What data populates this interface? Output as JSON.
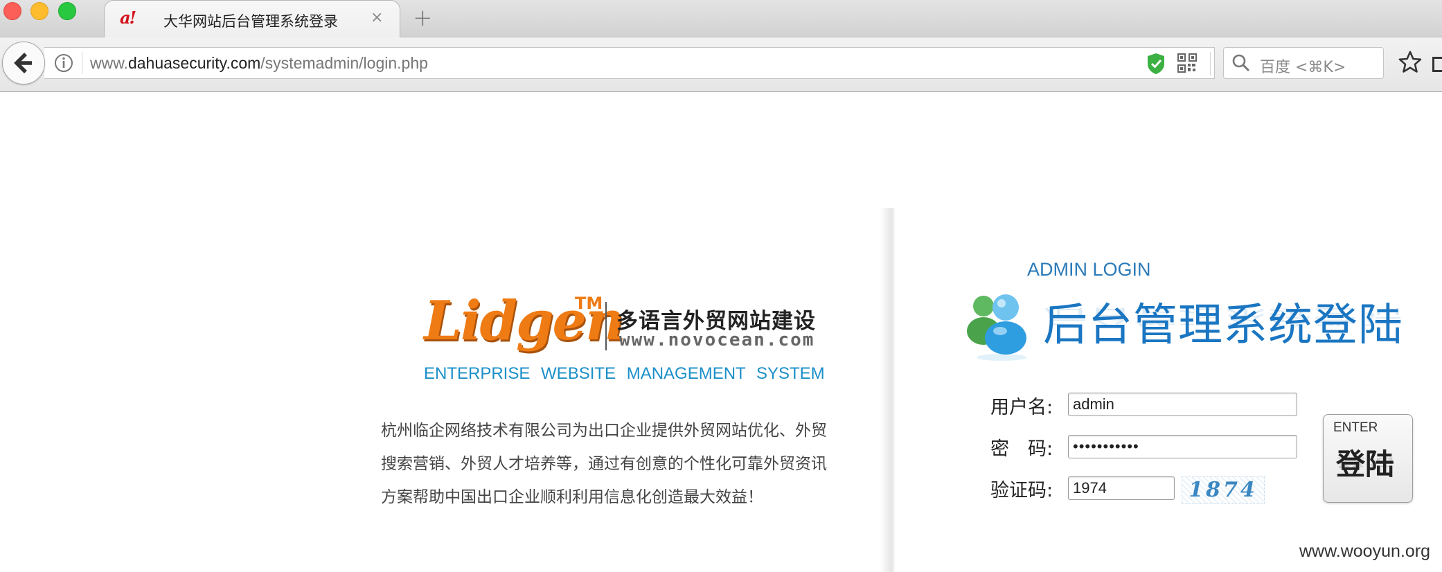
{
  "browser": {
    "tab": {
      "favicon_text": "a!",
      "title": "大华网站后台管理系统登录",
      "close_glyph": "×"
    },
    "new_tab_glyph": "+",
    "url": {
      "prefix": "www.",
      "domain": "dahuasecurity.com",
      "path": "/systemadmin/login.php"
    },
    "search": {
      "placeholder": "百度 <⌘K>"
    },
    "icons": [
      "back-arrow-icon",
      "info-icon",
      "shield-check-icon",
      "qr-code-icon",
      "reload-icon",
      "search-icon",
      "star-icon"
    ]
  },
  "brand": {
    "logo_text": "Lidgen",
    "tm": "TM",
    "tagline_cn": "多语言外贸网站建设",
    "site_url": "www.novocean.com",
    "subtitle": "ENTERPRISE  WEBSITE  MANAGEMENT  SYSTEM",
    "description": "杭州临企网络技术有限公司为出口企业提供外贸网站优化、外贸搜索营销、外贸人才培养等，通过有创意的个性化可靠外贸资讯方案帮助中国出口企业顺利利用信息化创造最大效益！"
  },
  "login": {
    "heading_en": "ADMIN LOGIN",
    "heading_cn": "后台管理系统登陆",
    "username_label": "用户名:",
    "username_value": "admin",
    "password_label": "密　码:",
    "password_value": "•••••••••••",
    "captcha_label": "验证码:",
    "captcha_value": "1974",
    "captcha_image_text": "1874",
    "submit_en": "ENTER",
    "submit_cn": "登陆"
  },
  "watermark": "www.wooyun.org",
  "colors": {
    "accent_blue": "#1a76c2",
    "brand_orange": "#ef7b14",
    "subtitle_blue": "#1a8fc9",
    "shield_green": "#3cb043"
  }
}
